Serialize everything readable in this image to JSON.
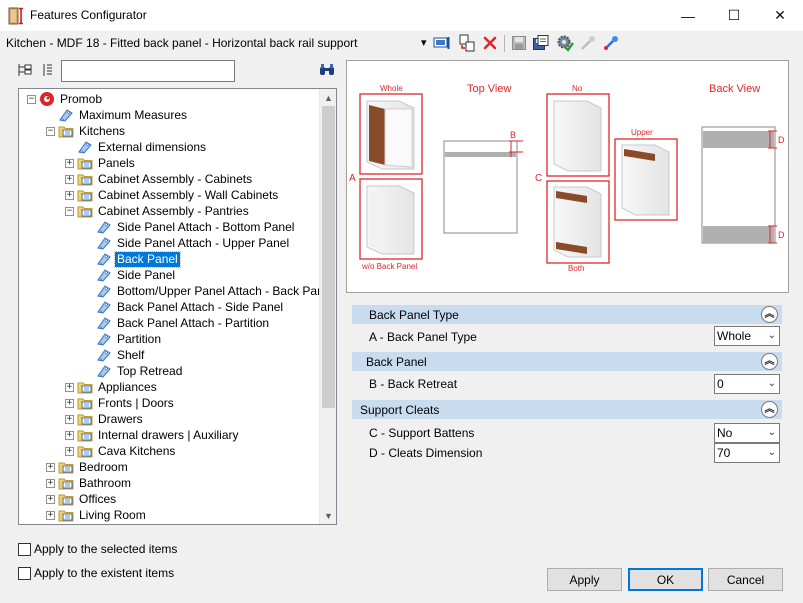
{
  "window": {
    "title": "Features Configurator",
    "minimize": "—",
    "maximize": "☐",
    "close": "✕"
  },
  "toolbar": {
    "config_path": "Kitchen - MDF 18 - Fitted back panel - Horizontal back rail support",
    "dropdown_glyph": "▾",
    "icons": [
      "apply-to-selection-icon",
      "copy-configuration-icon",
      "delete-icon",
      "save-icon",
      "save-as-icon",
      "settings-check-icon",
      "disabled-pick-icon",
      "pick-edit-icon"
    ]
  },
  "search": {
    "value": "",
    "placeholder": ""
  },
  "tree": {
    "items": [
      {
        "label": "Promob",
        "level": 0,
        "expander": "−",
        "icon": "promob-logo-icon"
      },
      {
        "label": "Maximum Measures",
        "level": 1,
        "expander": "",
        "icon": "tag-icon"
      },
      {
        "label": "Kitchens",
        "level": 1,
        "expander": "−",
        "icon": "folder-icon"
      },
      {
        "label": "External dimensions",
        "level": 2,
        "expander": "",
        "icon": "tag-icon"
      },
      {
        "label": "Panels",
        "level": 2,
        "expander": "+",
        "icon": "folder-icon"
      },
      {
        "label": "Cabinet Assembly - Cabinets",
        "level": 2,
        "expander": "+",
        "icon": "folder-icon"
      },
      {
        "label": "Cabinet Assembly - Wall Cabinets",
        "level": 2,
        "expander": "+",
        "icon": "folder-icon"
      },
      {
        "label": "Cabinet Assembly - Pantries",
        "level": 2,
        "expander": "−",
        "icon": "folder-icon"
      },
      {
        "label": "Side Panel Attach - Bottom Panel",
        "level": 3,
        "expander": "",
        "icon": "tag-icon"
      },
      {
        "label": "Side Panel Attach - Upper Panel",
        "level": 3,
        "expander": "",
        "icon": "tag-icon"
      },
      {
        "label": "Back Panel",
        "level": 3,
        "expander": "",
        "icon": "tag-icon",
        "selected": true
      },
      {
        "label": "Side Panel",
        "level": 3,
        "expander": "",
        "icon": "tag-icon"
      },
      {
        "label": "Bottom/Upper Panel Attach - Back Panel",
        "level": 3,
        "expander": "",
        "icon": "tag-icon"
      },
      {
        "label": "Back Panel Attach - Side Panel",
        "level": 3,
        "expander": "",
        "icon": "tag-icon"
      },
      {
        "label": "Back Panel Attach - Partition",
        "level": 3,
        "expander": "",
        "icon": "tag-icon"
      },
      {
        "label": "Partition",
        "level": 3,
        "expander": "",
        "icon": "tag-icon"
      },
      {
        "label": "Shelf",
        "level": 3,
        "expander": "",
        "icon": "tag-icon"
      },
      {
        "label": "Top Retread",
        "level": 3,
        "expander": "",
        "icon": "tag-icon"
      },
      {
        "label": "Appliances",
        "level": 2,
        "expander": "+",
        "icon": "folder-icon"
      },
      {
        "label": "Fronts | Doors",
        "level": 2,
        "expander": "+",
        "icon": "folder-icon"
      },
      {
        "label": "Drawers",
        "level": 2,
        "expander": "+",
        "icon": "folder-icon"
      },
      {
        "label": "Internal drawers | Auxiliary",
        "level": 2,
        "expander": "+",
        "icon": "folder-icon"
      },
      {
        "label": "Cava Kitchens",
        "level": 2,
        "expander": "+",
        "icon": "folder-icon"
      },
      {
        "label": "Bedroom",
        "level": 1,
        "expander": "+",
        "icon": "folder-icon"
      },
      {
        "label": "Bathroom",
        "level": 1,
        "expander": "+",
        "icon": "folder-icon"
      },
      {
        "label": "Offices",
        "level": 1,
        "expander": "+",
        "icon": "folder-icon"
      },
      {
        "label": "Living Room",
        "level": 1,
        "expander": "+",
        "icon": "folder-icon"
      },
      {
        "label": "",
        "level": 1,
        "expander": "+",
        "icon": "folder-icon"
      }
    ],
    "scroll_up": "▲",
    "scroll_down": "▼"
  },
  "options": {
    "apply_selected": "Apply to the selected items",
    "apply_existent": "Apply to the existent items"
  },
  "preview": {
    "whole": "Whole",
    "top_view": "Top View",
    "wo_back_panel": "w/o Back Panel",
    "no": "No",
    "upper": "Upper",
    "both": "Both",
    "back_view": "Back View",
    "label_a": "A",
    "label_b": "B",
    "label_c": "C",
    "label_d": "D"
  },
  "properties": {
    "sections": [
      {
        "title": "Back Panel Type",
        "rows": [
          {
            "label": "A - Back Panel Type",
            "value": "Whole"
          }
        ]
      },
      {
        "title": "Back Panel",
        "rows": [
          {
            "label": "B - Back Retreat",
            "value": "0"
          }
        ]
      },
      {
        "title": "Support Cleats",
        "rows": [
          {
            "label": "C - Support Battens",
            "value": "No"
          },
          {
            "label": "D - Cleats Dimension",
            "value": "70"
          }
        ]
      }
    ],
    "collapse_glyph": "︽",
    "dropdown_glyph": "⌄"
  },
  "buttons": {
    "apply": "Apply",
    "ok": "OK",
    "cancel": "Cancel"
  },
  "colors": {
    "accent_red": "#e0262b",
    "selection": "#0078d7",
    "section_header": "#c8dbef",
    "wood": "#8a4b2a"
  }
}
